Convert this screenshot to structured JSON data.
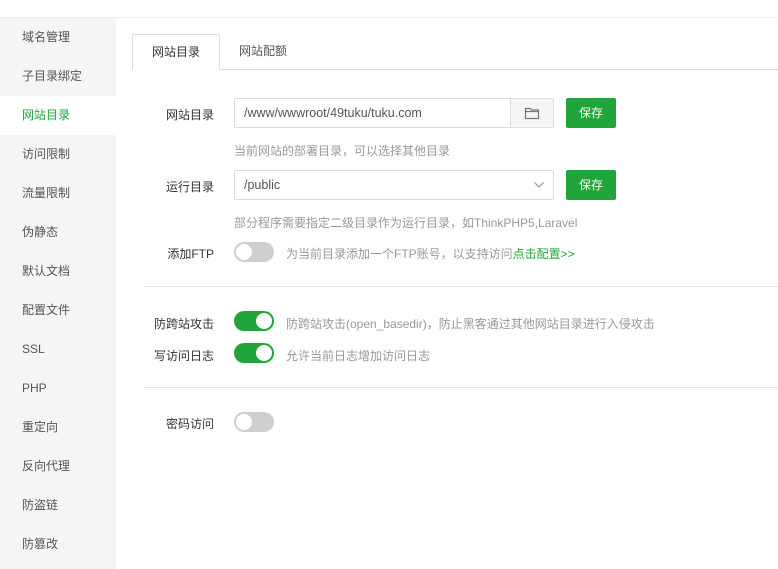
{
  "window": {
    "title_fragment": ""
  },
  "sidebar": {
    "items": [
      {
        "label": "域名管理",
        "active": false
      },
      {
        "label": "子目录绑定",
        "active": false
      },
      {
        "label": "网站目录",
        "active": true
      },
      {
        "label": "访问限制",
        "active": false
      },
      {
        "label": "流量限制",
        "active": false
      },
      {
        "label": "伪静态",
        "active": false
      },
      {
        "label": "默认文档",
        "active": false
      },
      {
        "label": "配置文件",
        "active": false
      },
      {
        "label": "SSL",
        "active": false
      },
      {
        "label": "PHP",
        "active": false
      },
      {
        "label": "重定向",
        "active": false
      },
      {
        "label": "反向代理",
        "active": false
      },
      {
        "label": "防盗链",
        "active": false
      },
      {
        "label": "防篡改",
        "active": false
      }
    ]
  },
  "tabs": [
    {
      "label": "网站目录",
      "active": true
    },
    {
      "label": "网站配额",
      "active": false
    }
  ],
  "site_dir": {
    "label": "网站目录",
    "value": "/www/wwwroot/49tuku/tuku.com",
    "save_label": "保存",
    "hint": "当前网站的部署目录，可以选择其他目录"
  },
  "run_dir": {
    "label": "运行目录",
    "selected": "/public",
    "save_label": "保存",
    "hint": "部分程序需要指定二级目录作为运行目录，如ThinkPHP5,Laravel"
  },
  "ftp": {
    "label": "添加FTP",
    "enabled": false,
    "hint": "为当前目录添加一个FTP账号，以支持访问",
    "link": "点击配置>>"
  },
  "anti_xss": {
    "label": "防跨站攻击",
    "enabled": true,
    "hint": "防跨站攻击(open_basedir)，防止黑客通过其他网站目录进行入侵攻击"
  },
  "access_log": {
    "label": "写访问日志",
    "enabled": true,
    "hint": "允许当前日志增加访问日志"
  },
  "password_access": {
    "label": "密码访问",
    "enabled": false
  },
  "colors": {
    "accent": "#20a53a",
    "sidebar_bg": "#f5f5f5",
    "toggle_off": "#cfcfcf"
  }
}
